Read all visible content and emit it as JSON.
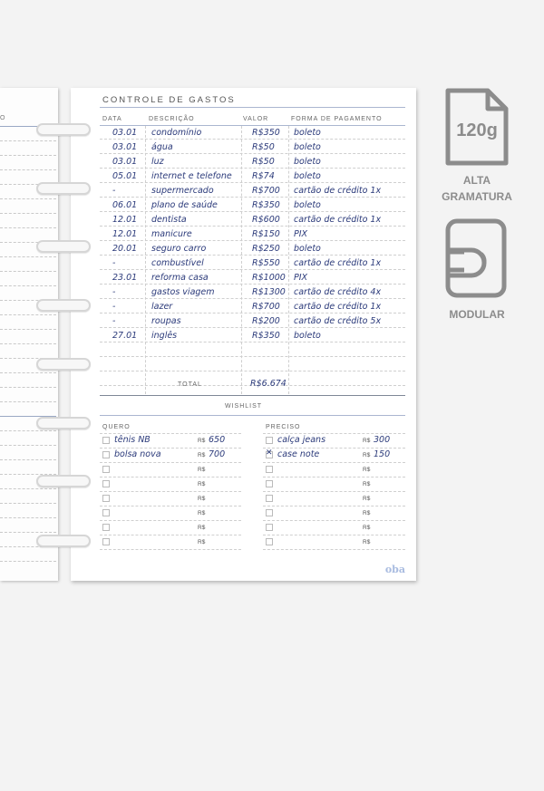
{
  "expenses": {
    "title": "CONTROLE DE GASTOS",
    "headers": {
      "date": "DATA",
      "description": "DESCRIÇÃO",
      "value": "VALOR",
      "payment": "FORMA DE PAGAMENTO"
    },
    "rows": [
      {
        "date": "03.01",
        "desc": "condomínio",
        "value": "R$350",
        "payment": "boleto"
      },
      {
        "date": "03.01",
        "desc": "água",
        "value": "R$50",
        "payment": "boleto"
      },
      {
        "date": "03.01",
        "desc": "luz",
        "value": "R$50",
        "payment": "boleto"
      },
      {
        "date": "05.01",
        "desc": "internet e telefone",
        "value": "R$74",
        "payment": "boleto"
      },
      {
        "date": "-",
        "desc": "supermercado",
        "value": "R$700",
        "payment": "cartão de crédito 1x"
      },
      {
        "date": "06.01",
        "desc": "plano de saúde",
        "value": "R$350",
        "payment": "boleto"
      },
      {
        "date": "12.01",
        "desc": "dentista",
        "value": "R$600",
        "payment": "cartão de crédito 1x"
      },
      {
        "date": "12.01",
        "desc": "manicure",
        "value": "R$150",
        "payment": "PIX"
      },
      {
        "date": "20.01",
        "desc": "seguro carro",
        "value": "R$250",
        "payment": "boleto"
      },
      {
        "date": "-",
        "desc": "combustível",
        "value": "R$550",
        "payment": "cartão de crédito 1x"
      },
      {
        "date": "23.01",
        "desc": "reforma casa",
        "value": "R$1000",
        "payment": "PIX"
      },
      {
        "date": "-",
        "desc": "gastos viagem",
        "value": "R$1300",
        "payment": "cartão de crédito 4x"
      },
      {
        "date": "-",
        "desc": "lazer",
        "value": "R$700",
        "payment": "cartão de crédito 1x"
      },
      {
        "date": "-",
        "desc": "roupas",
        "value": "R$200",
        "payment": "cartão de crédito 5x"
      },
      {
        "date": "27.01",
        "desc": "inglês",
        "value": "R$350",
        "payment": "boleto"
      }
    ],
    "total_label": "TOTAL",
    "total_value": "R$6.674"
  },
  "wishlist": {
    "title": "WISHLIST",
    "quero": {
      "label": "QUERO",
      "items": [
        {
          "name": "tênis NB",
          "value": "650",
          "checked": false
        },
        {
          "name": "bolsa nova",
          "value": "700",
          "checked": false
        },
        {
          "name": "",
          "value": "",
          "checked": false
        },
        {
          "name": "",
          "value": "",
          "checked": false
        },
        {
          "name": "",
          "value": "",
          "checked": false
        },
        {
          "name": "",
          "value": "",
          "checked": false
        },
        {
          "name": "",
          "value": "",
          "checked": false
        },
        {
          "name": "",
          "value": "",
          "checked": false
        }
      ]
    },
    "preciso": {
      "label": "PRECISO",
      "items": [
        {
          "name": "calça jeans",
          "value": "300",
          "checked": false
        },
        {
          "name": "case note",
          "value": "150",
          "checked": true
        },
        {
          "name": "",
          "value": "",
          "checked": false
        },
        {
          "name": "",
          "value": "",
          "checked": false
        },
        {
          "name": "",
          "value": "",
          "checked": false
        },
        {
          "name": "",
          "value": "",
          "checked": false
        },
        {
          "name": "",
          "value": "",
          "checked": false
        },
        {
          "name": "",
          "value": "",
          "checked": false
        }
      ]
    },
    "currency": "R$"
  },
  "brand": "oba",
  "left_page_label": "O",
  "features": [
    {
      "icon": "paper-weight-icon",
      "badge": "120g",
      "label1": "ALTA",
      "label2": "GRAMATURA"
    },
    {
      "icon": "modular-icon",
      "label1": "MODULAR"
    }
  ],
  "colors": {
    "ink": "#2b3a7a",
    "icon_gray": "#8c8c8c",
    "brand": "#a9bce0"
  }
}
